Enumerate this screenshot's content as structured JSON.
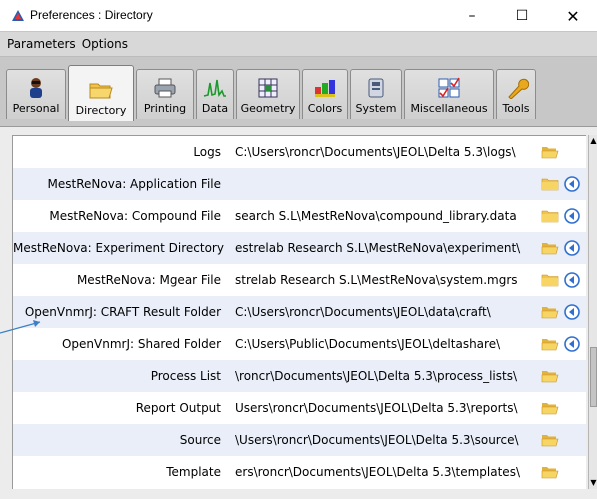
{
  "window": {
    "title": "Preferences : Directory",
    "controls": {
      "minimize": "–",
      "maximize": "☐",
      "close": "✕"
    }
  },
  "menu": [
    "Parameters",
    "Options"
  ],
  "tabs": [
    {
      "label": "Personal",
      "icon": "person-icon",
      "active": false
    },
    {
      "label": "Directory",
      "icon": "folder-icon",
      "active": true
    },
    {
      "label": "Printing",
      "icon": "printer-icon",
      "active": false
    },
    {
      "label": "Data",
      "icon": "spectrum-icon",
      "active": false
    },
    {
      "label": "Geometry",
      "icon": "geometry-icon",
      "active": false
    },
    {
      "label": "Colors",
      "icon": "colors-icon",
      "active": false
    },
    {
      "label": "System",
      "icon": "system-icon",
      "active": false
    },
    {
      "label": "Miscellaneous",
      "icon": "checklist-icon",
      "active": false
    },
    {
      "label": "Tools",
      "icon": "wrench-icon",
      "active": false
    }
  ],
  "rows": [
    {
      "label": "Logs",
      "path": "C:\\Users\\roncr\\Documents\\JEOL\\Delta 5.3\\logs\\",
      "folder_style": "open",
      "back": false
    },
    {
      "label": "MestReNova: Application File",
      "path": "",
      "folder_style": "closed",
      "back": true
    },
    {
      "label": "MestReNova: Compound File",
      "path": "search S.L\\MestReNova\\compound_library.data",
      "folder_style": "closed",
      "back": true
    },
    {
      "label": "MestReNova: Experiment Directory",
      "path": "estrelab Research S.L\\MestReNova\\experiment\\",
      "folder_style": "open",
      "back": true
    },
    {
      "label": "MestReNova: Mgear File",
      "path": "strelab Research S.L\\MestReNova\\system.mgrs",
      "folder_style": "closed",
      "back": true
    },
    {
      "label": "OpenVnmrJ: CRAFT Result Folder",
      "path": "C:\\Users\\roncr\\Documents\\JEOL\\data\\craft\\",
      "folder_style": "open",
      "back": true
    },
    {
      "label": "OpenVnmrJ: Shared Folder",
      "path": "C:\\Users\\Public\\Documents\\JEOL\\deltashare\\",
      "folder_style": "open",
      "back": true
    },
    {
      "label": "Process List",
      "path": "\\roncr\\Documents\\JEOL\\Delta 5.3\\process_lists\\",
      "folder_style": "open",
      "back": false
    },
    {
      "label": "Report Output",
      "path": "Users\\roncr\\Documents\\JEOL\\Delta 5.3\\reports\\",
      "folder_style": "open",
      "back": false
    },
    {
      "label": "Source",
      "path": "\\Users\\roncr\\Documents\\JEOL\\Delta 5.3\\source\\",
      "folder_style": "open",
      "back": false
    },
    {
      "label": "Template",
      "path": "ers\\roncr\\Documents\\JEOL\\Delta 5.3\\templates\\",
      "folder_style": "open",
      "back": false
    }
  ],
  "colors": {
    "row_alt": "#e9eef8",
    "folder": "#f2c24a",
    "back_button": "#2f6fd1",
    "annotation_arrow": "#3d7fc7"
  }
}
